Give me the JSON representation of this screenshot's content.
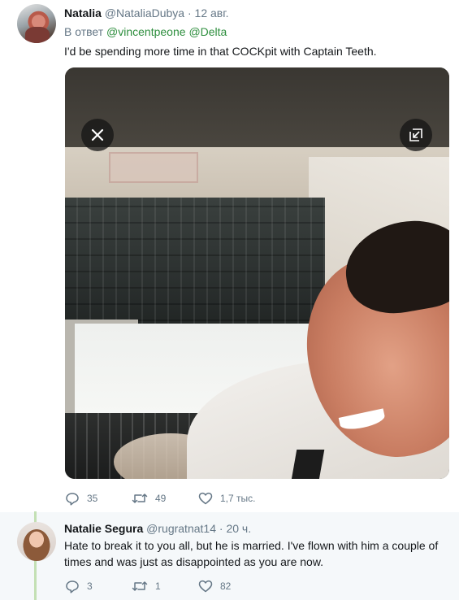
{
  "tweet1": {
    "name": "Natalia",
    "handle": "@NataliaDubya",
    "separator": "·",
    "time": "12 авг.",
    "reply_prefix": "В ответ",
    "mentions": [
      "@vincentpeone",
      "@Delta"
    ],
    "text": "I'd be spending more time in that COCKpit with Captain Teeth.",
    "media": {
      "close_icon": "close-icon",
      "popout_icon": "popout-icon"
    },
    "actions": {
      "replies": "35",
      "retweets": "49",
      "likes": "1,7 тыс."
    }
  },
  "tweet2": {
    "name": "Natalie Segura",
    "handle": "@rugratnat14",
    "separator": "·",
    "time": "20 ч.",
    "text": "Hate to break it to you all, but he is married. I've flown with him a couple of times and was just as disappointed as you are now.",
    "actions": {
      "replies": "3",
      "retweets": "1",
      "likes": "82"
    }
  },
  "colors": {
    "thread_line": "#c3e0b4",
    "muted": "#657786",
    "mention": "#2f8f3f",
    "reply_bg": "#f5f8fa"
  }
}
